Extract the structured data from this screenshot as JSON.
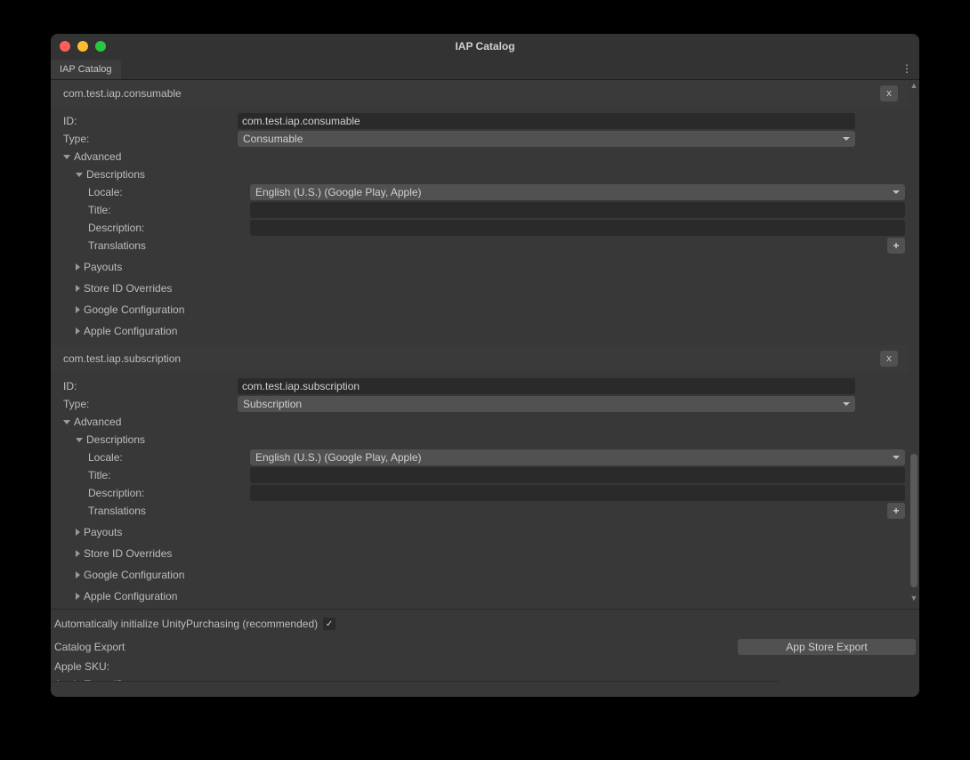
{
  "window": {
    "title": "IAP Catalog"
  },
  "tab": {
    "label": "IAP Catalog"
  },
  "products": [
    {
      "header": "com.test.iap.consumable",
      "x": "x",
      "id_label": "ID:",
      "id_value": "com.test.iap.consumable",
      "type_label": "Type:",
      "type_value": "Consumable",
      "advanced_label": "Advanced",
      "descriptions_label": "Descriptions",
      "locale_label": "Locale:",
      "locale_value": "English (U.S.) (Google Play, Apple)",
      "title_label": "Title:",
      "title_value": "",
      "description_label": "Description:",
      "description_value": "",
      "translations_label": "Translations",
      "plus": "+",
      "folds": {
        "payouts": "Payouts",
        "store_overrides": "Store ID Overrides",
        "google": "Google Configuration",
        "apple": "Apple Configuration"
      }
    },
    {
      "header": "com.test.iap.subscription",
      "x": "x",
      "id_label": "ID:",
      "id_value": "com.test.iap.subscription",
      "type_label": "Type:",
      "type_value": "Subscription",
      "advanced_label": "Advanced",
      "descriptions_label": "Descriptions",
      "locale_label": "Locale:",
      "locale_value": "English (U.S.) (Google Play, Apple)",
      "title_label": "Title:",
      "title_value": "",
      "description_label": "Description:",
      "description_value": "",
      "translations_label": "Translations",
      "plus": "+",
      "folds": {
        "payouts": "Payouts",
        "store_overrides": "Store ID Overrides",
        "google": "Google Configuration",
        "apple": "Apple Configuration"
      }
    }
  ],
  "footer": {
    "auto_init_label": "Automatically initialize UnityPurchasing (recommended)",
    "auto_init_checked": "✓",
    "catalog_export_label": "Catalog Export",
    "app_store_export_label": "App Store Export",
    "apple_sku_label": "Apple SKU:",
    "apple_sku_value": "",
    "apple_team_label": "Apple Team ID:",
    "apple_team_value": ""
  }
}
